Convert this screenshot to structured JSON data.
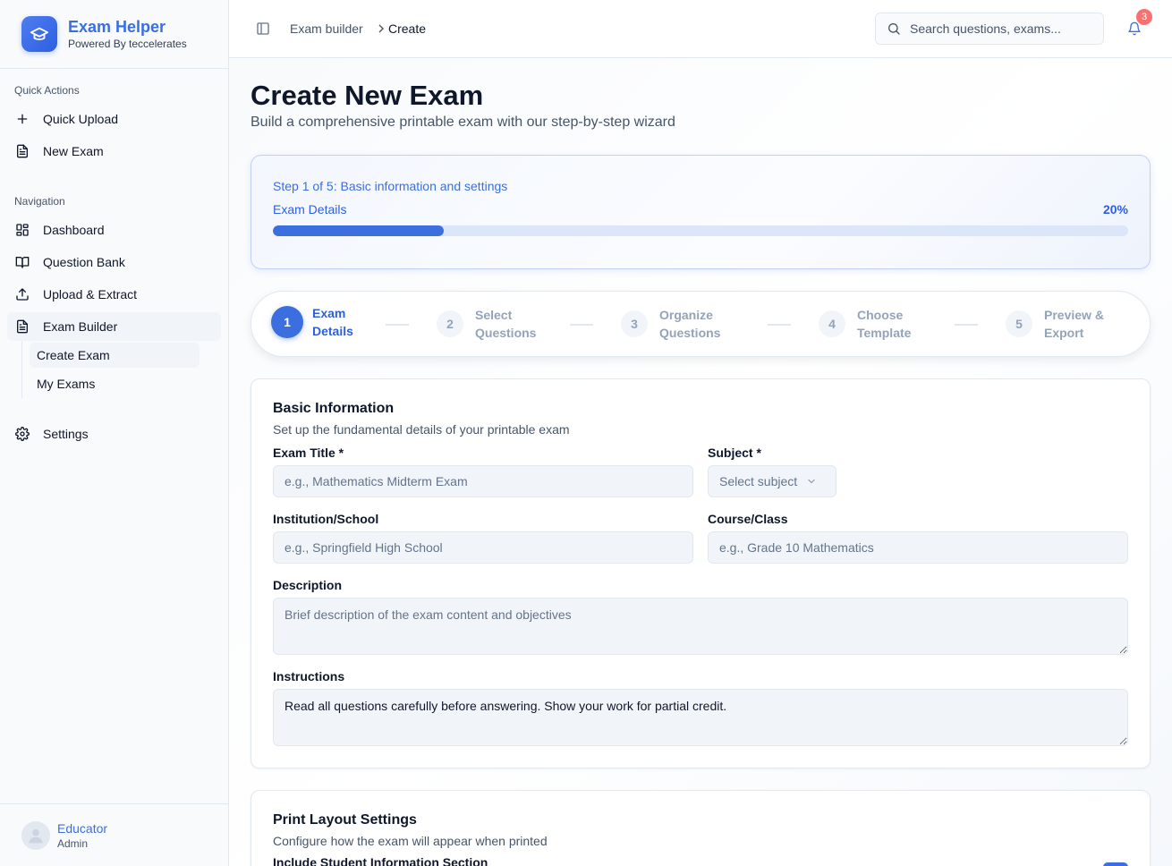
{
  "brand": {
    "title": "Exam Helper",
    "subtitle": "Powered By teccelerates"
  },
  "sidebar": {
    "quick_actions_label": "Quick Actions",
    "quick_actions": [
      {
        "label": "Quick Upload",
        "icon": "plus-icon"
      },
      {
        "label": "New Exam",
        "icon": "file-text-icon"
      }
    ],
    "navigation_label": "Navigation",
    "navigation": [
      {
        "label": "Dashboard",
        "icon": "grid-icon"
      },
      {
        "label": "Question Bank",
        "icon": "book-open-icon"
      },
      {
        "label": "Upload & Extract",
        "icon": "upload-icon"
      },
      {
        "label": "Exam Builder",
        "icon": "file-text-icon"
      }
    ],
    "exam_builder_sub": [
      {
        "label": "Create Exam",
        "active": true
      },
      {
        "label": "My Exams",
        "active": false
      }
    ],
    "settings": {
      "label": "Settings",
      "icon": "gear-icon"
    }
  },
  "user": {
    "name": "Educator",
    "role": "Admin"
  },
  "header": {
    "breadcrumb": [
      "Exam builder",
      "Create"
    ],
    "search_placeholder": "Search questions, exams...",
    "notification_count": "3"
  },
  "page": {
    "title": "Create New Exam",
    "subtitle": "Build a comprehensive printable exam with our step-by-step wizard"
  },
  "progress": {
    "step_text": "Step 1 of 5: Basic information and settings",
    "label": "Exam Details",
    "percent_text": "20%",
    "percent": 20
  },
  "steps": [
    {
      "num": "1",
      "label": "Exam Details",
      "current": true
    },
    {
      "num": "2",
      "label": "Select Questions",
      "current": false
    },
    {
      "num": "3",
      "label": "Organize Questions",
      "current": false
    },
    {
      "num": "4",
      "label": "Choose Template",
      "current": false
    },
    {
      "num": "5",
      "label": "Preview & Export",
      "current": false
    }
  ],
  "basic_info": {
    "title": "Basic Information",
    "description": "Set up the fundamental details of your printable exam",
    "exam_title": {
      "label": "Exam Title *",
      "placeholder": "e.g., Mathematics Midterm Exam",
      "value": ""
    },
    "subject": {
      "label": "Subject *",
      "placeholder": "Select subject"
    },
    "institution": {
      "label": "Institution/School",
      "placeholder": "e.g., Springfield High School",
      "value": ""
    },
    "course": {
      "label": "Course/Class",
      "placeholder": "e.g., Grade 10 Mathematics",
      "value": ""
    },
    "description_field": {
      "label": "Description",
      "placeholder": "Brief description of the exam content and objectives",
      "value": ""
    },
    "instructions": {
      "label": "Instructions",
      "value": "Read all questions carefully before answering. Show your work for partial credit."
    }
  },
  "print_layout": {
    "title": "Print Layout Settings",
    "description": "Configure how the exam will appear when printed",
    "student_info_label": "Include Student Information Section",
    "student_info_enabled": true
  },
  "colors": {
    "accent": "#3b6fe0",
    "badge": "#f87171"
  }
}
